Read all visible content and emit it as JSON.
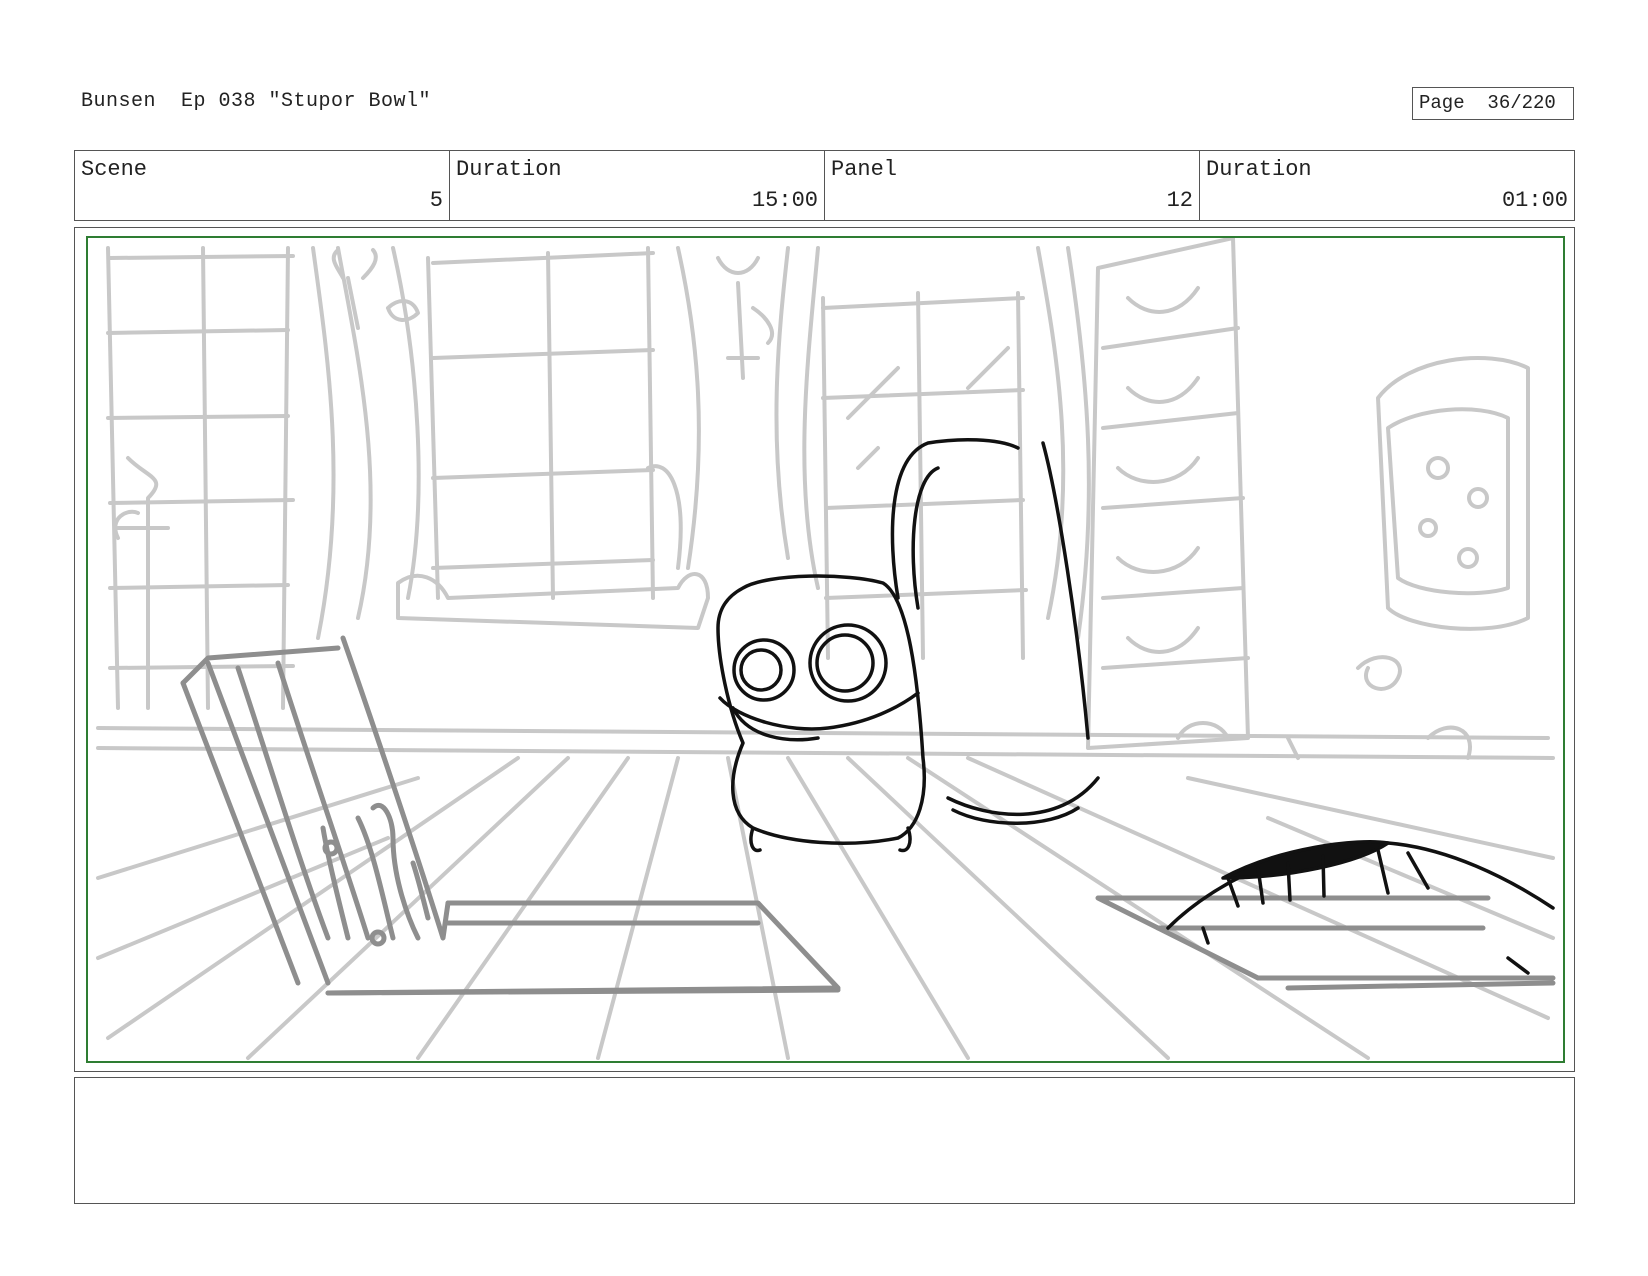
{
  "header": {
    "title": "Bunsen  Ep 038 \"Stupor Bowl\"",
    "page": "Page  36/220"
  },
  "info": {
    "scene_label": "Scene",
    "scene_value": "5",
    "scene_duration_label": "Duration",
    "scene_duration_value": "15:00",
    "panel_label": "Panel",
    "panel_value": "12",
    "panel_duration_label": "Duration",
    "panel_duration_value": "01:00"
  },
  "panel": {
    "frame_color": "#2e7d32",
    "background_line_color": "#c8c8c8",
    "mid_line_color": "#8e8e8e",
    "character_line_color": "#111111"
  },
  "notes": {
    "text": ""
  }
}
